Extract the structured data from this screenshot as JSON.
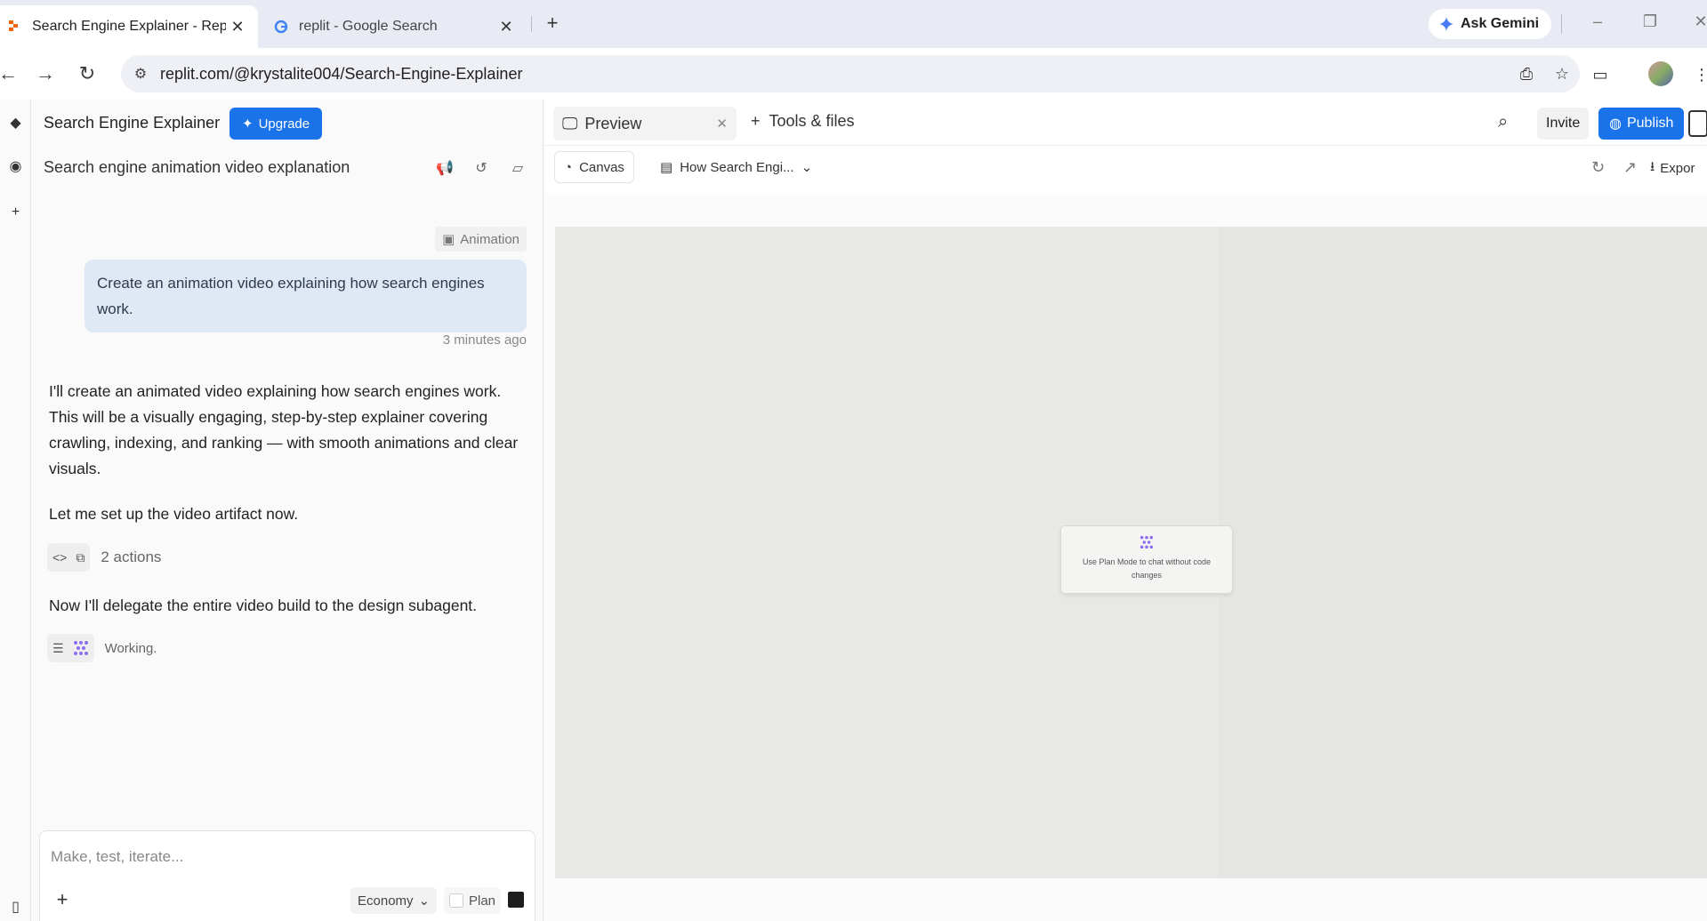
{
  "browser": {
    "tabs": [
      {
        "title": "Search Engine Explainer - Replit",
        "close": "✕"
      },
      {
        "title": "replit - Google Search",
        "close": "✕"
      }
    ],
    "new_tab": "+",
    "ask_gemini": "Ask Gemini",
    "url": "replit.com/@krystalite004/Search-Engine-Explainer"
  },
  "app": {
    "project_title": "Search Engine Explainer",
    "upgrade_label": "Upgrade",
    "chat_title": "Search engine animation video explanation",
    "tag_label": "Animation",
    "user_message": "Create an animation video explaining how search engines work.",
    "user_message_time": "3 minutes ago",
    "agent_messages": [
      "I'll create an animated video explaining how search engines work. This will be a visually engaging, step-by-step explainer covering crawling, indexing, and ranking — with smooth animations and clear visuals.",
      "Let me set up the video artifact now.",
      "Now I'll delegate the entire video build to the design subagent."
    ],
    "actions_label": "2 actions",
    "working_label": "Working.",
    "composer": {
      "placeholder": "Make, test, iterate...",
      "mode": "Economy",
      "plan_label": "Plan"
    }
  },
  "pane": {
    "preview_tab": "Preview",
    "tools_label": "Tools & files",
    "invite_label": "Invite",
    "publish_label": "Publish",
    "canvas_label": "Canvas",
    "file_label": "How Search Engi...",
    "export_label": "Expor",
    "canvas_hint": "Use Plan Mode to chat without code changes"
  },
  "colors": {
    "accent": "#1a73e8",
    "user_bubble": "#dfe9f5"
  }
}
